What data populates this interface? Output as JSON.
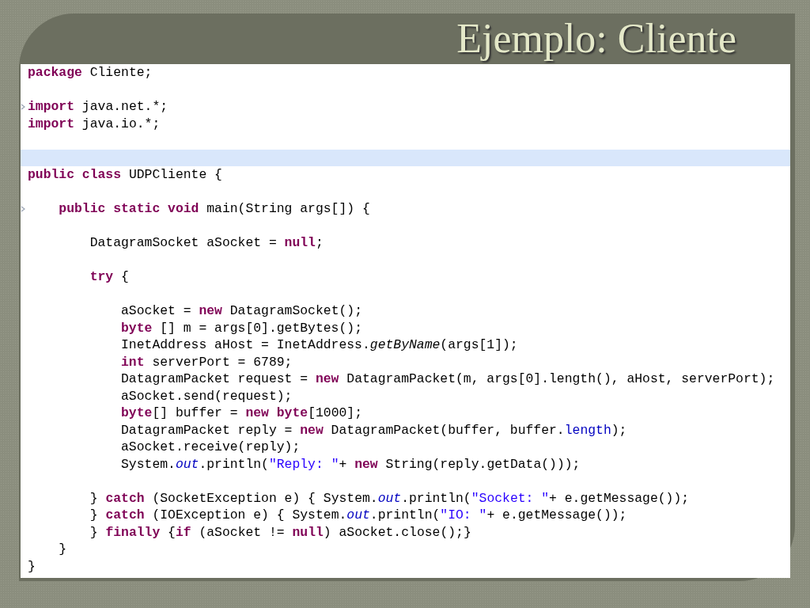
{
  "slide": {
    "title": "Ejemplo: Cliente"
  },
  "editor": {
    "lines": [
      {
        "highlighted": false,
        "tokens": [
          {
            "kind": "keyword",
            "text": "package"
          },
          {
            "kind": "plain",
            "text": " Cliente;"
          }
        ]
      },
      {
        "highlighted": false
      },
      {
        "highlighted": false,
        "fold_marker": true,
        "tokens": [
          {
            "kind": "keyword",
            "text": "import"
          },
          {
            "kind": "plain",
            "text": " java.net.*;"
          }
        ]
      },
      {
        "highlighted": false,
        "tokens": [
          {
            "kind": "keyword",
            "text": "import"
          },
          {
            "kind": "plain",
            "text": " java.io.*;"
          }
        ]
      },
      {
        "highlighted": false
      },
      {
        "highlighted": true
      },
      {
        "highlighted": false,
        "tokens": [
          {
            "kind": "keyword",
            "text": "public class"
          },
          {
            "kind": "plain",
            "text": " UDPCliente {"
          }
        ]
      },
      {
        "highlighted": false
      },
      {
        "highlighted": false,
        "fold_marker": true,
        "tokens": [
          {
            "kind": "keyword",
            "text": "    public static void"
          },
          {
            "kind": "plain",
            "text": " main(String args[]) {"
          }
        ]
      },
      {
        "highlighted": false
      },
      {
        "highlighted": false,
        "tokens": [
          {
            "kind": "plain",
            "text": "        DatagramSocket aSocket = "
          },
          {
            "kind": "keyword",
            "text": "null"
          },
          {
            "kind": "plain",
            "text": ";"
          }
        ]
      },
      {
        "highlighted": false
      },
      {
        "highlighted": false,
        "tokens": [
          {
            "kind": "keyword",
            "text": "        try"
          },
          {
            "kind": "plain",
            "text": " {"
          }
        ]
      },
      {
        "highlighted": false
      },
      {
        "highlighted": false,
        "tokens": [
          {
            "kind": "plain",
            "text": "            aSocket = "
          },
          {
            "kind": "keyword",
            "text": "new"
          },
          {
            "kind": "plain",
            "text": " DatagramSocket();"
          }
        ]
      },
      {
        "highlighted": false,
        "tokens": [
          {
            "kind": "keyword",
            "text": "            byte"
          },
          {
            "kind": "plain",
            "text": " [] m = args[0].getBytes();"
          }
        ]
      },
      {
        "highlighted": false,
        "tokens": [
          {
            "kind": "plain",
            "text": "            InetAddress aHost = InetAddress."
          },
          {
            "kind": "static_method",
            "text": "getByName"
          },
          {
            "kind": "plain",
            "text": "(args[1]);"
          }
        ]
      },
      {
        "highlighted": false,
        "tokens": [
          {
            "kind": "keyword",
            "text": "            int"
          },
          {
            "kind": "plain",
            "text": " serverPort = 6789;"
          }
        ]
      },
      {
        "highlighted": false,
        "tokens": [
          {
            "kind": "plain",
            "text": "            DatagramPacket request = "
          },
          {
            "kind": "keyword",
            "text": "new"
          },
          {
            "kind": "plain",
            "text": " DatagramPacket(m, args[0].length(), aHost, serverPort);"
          }
        ]
      },
      {
        "highlighted": false,
        "tokens": [
          {
            "kind": "plain",
            "text": "            aSocket.send(request);"
          }
        ]
      },
      {
        "highlighted": false,
        "tokens": [
          {
            "kind": "keyword",
            "text": "            byte"
          },
          {
            "kind": "plain",
            "text": "[] buffer = "
          },
          {
            "kind": "keyword",
            "text": "new byte"
          },
          {
            "kind": "plain",
            "text": "[1000];"
          }
        ]
      },
      {
        "highlighted": false,
        "tokens": [
          {
            "kind": "plain",
            "text": "            DatagramPacket reply = "
          },
          {
            "kind": "keyword",
            "text": "new"
          },
          {
            "kind": "plain",
            "text": " DatagramPacket(buffer, buffer."
          },
          {
            "kind": "field",
            "text": "length"
          },
          {
            "kind": "plain",
            "text": ");"
          }
        ]
      },
      {
        "highlighted": false,
        "tokens": [
          {
            "kind": "plain",
            "text": "            aSocket.receive(reply);"
          }
        ]
      },
      {
        "highlighted": false,
        "tokens": [
          {
            "kind": "plain",
            "text": "            System."
          },
          {
            "kind": "static_field",
            "text": "out"
          },
          {
            "kind": "plain",
            "text": ".println("
          },
          {
            "kind": "string",
            "text": "\"Reply: \""
          },
          {
            "kind": "plain",
            "text": "+ "
          },
          {
            "kind": "keyword",
            "text": "new"
          },
          {
            "kind": "plain",
            "text": " String(reply.getData()));"
          }
        ]
      },
      {
        "highlighted": false
      },
      {
        "highlighted": false,
        "tokens": [
          {
            "kind": "plain",
            "text": "        } "
          },
          {
            "kind": "keyword",
            "text": "catch"
          },
          {
            "kind": "plain",
            "text": " (SocketException e) { System."
          },
          {
            "kind": "static_field",
            "text": "out"
          },
          {
            "kind": "plain",
            "text": ".println("
          },
          {
            "kind": "string",
            "text": "\"Socket: \""
          },
          {
            "kind": "plain",
            "text": "+ e.getMessage());"
          }
        ]
      },
      {
        "highlighted": false,
        "tokens": [
          {
            "kind": "plain",
            "text": "        } "
          },
          {
            "kind": "keyword",
            "text": "catch"
          },
          {
            "kind": "plain",
            "text": " (IOException e) { System."
          },
          {
            "kind": "static_field",
            "text": "out"
          },
          {
            "kind": "plain",
            "text": ".println("
          },
          {
            "kind": "string",
            "text": "\"IO: \""
          },
          {
            "kind": "plain",
            "text": "+ e.getMessage());"
          }
        ]
      },
      {
        "highlighted": false,
        "tokens": [
          {
            "kind": "plain",
            "text": "        } "
          },
          {
            "kind": "keyword",
            "text": "finally"
          },
          {
            "kind": "plain",
            "text": " {"
          },
          {
            "kind": "keyword",
            "text": "if"
          },
          {
            "kind": "plain",
            "text": " (aSocket != "
          },
          {
            "kind": "keyword",
            "text": "null"
          },
          {
            "kind": "plain",
            "text": ") aSocket.close();}"
          }
        ]
      },
      {
        "highlighted": false,
        "tokens": [
          {
            "kind": "plain",
            "text": "    }"
          }
        ]
      },
      {
        "highlighted": false,
        "tokens": [
          {
            "kind": "plain",
            "text": "}"
          }
        ]
      }
    ]
  }
}
